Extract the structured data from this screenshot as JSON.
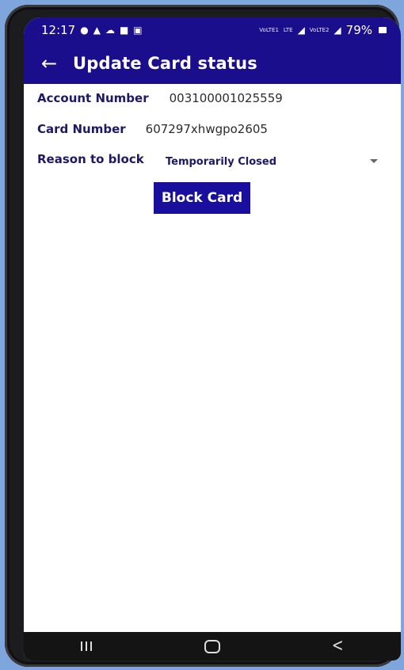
{
  "status_bar": {
    "time": "12:17",
    "left_icons": [
      "chat-icon",
      "alert-icon",
      "cloud-icon",
      "mail-icon",
      "image-icon"
    ],
    "network_1": "VoLTE1",
    "network_2": "LTE",
    "network_3": "VoLTE2",
    "battery": "79%"
  },
  "app_bar": {
    "title": "Update Card status",
    "back_icon": "arrow-left-icon"
  },
  "form": {
    "account_label": "Account Number",
    "account_value": "003100001025559",
    "card_label": "Card Number",
    "card_value": "607297xhwgpo2605",
    "reason_label": "Reason to block",
    "reason_value": "Temporarily Closed"
  },
  "actions": {
    "block_label": "Block Card"
  },
  "colors": {
    "primary": "#1a0e8c",
    "label": "#1e1865",
    "background": "#ffffff"
  }
}
